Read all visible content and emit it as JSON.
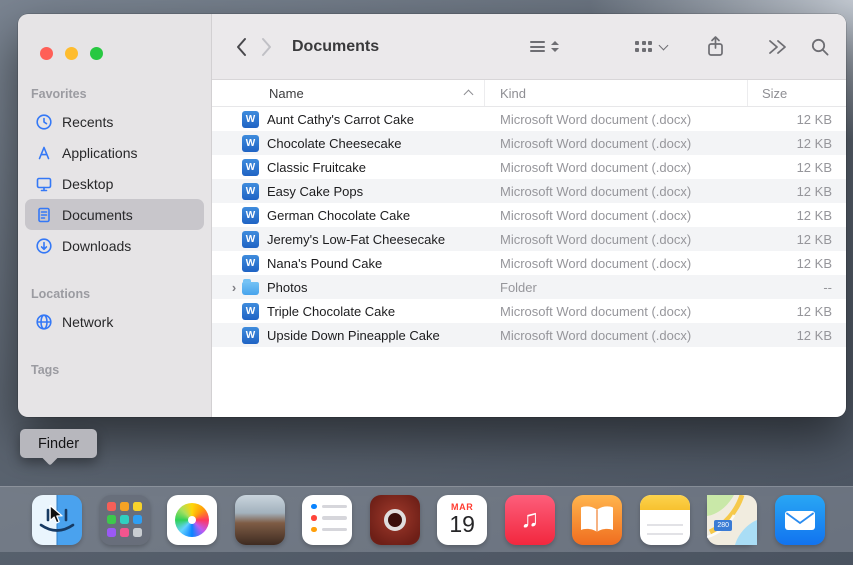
{
  "window": {
    "controls": [
      "close",
      "minimize",
      "zoom"
    ],
    "toolbar": {
      "title": "Documents",
      "icons": [
        "back",
        "forward",
        "view-list",
        "group",
        "share",
        "more",
        "search"
      ]
    },
    "sidebar": {
      "sections": [
        {
          "label": "Favorites",
          "items": [
            {
              "label": "Recents",
              "icon": "clock-icon"
            },
            {
              "label": "Applications",
              "icon": "applications-icon"
            },
            {
              "label": "Desktop",
              "icon": "desktop-icon"
            },
            {
              "label": "Documents",
              "icon": "document-icon",
              "selected": true
            },
            {
              "label": "Downloads",
              "icon": "download-icon"
            }
          ]
        },
        {
          "label": "Locations",
          "items": [
            {
              "label": "Network",
              "icon": "globe-icon"
            }
          ]
        },
        {
          "label": "Tags",
          "items": []
        }
      ]
    },
    "list": {
      "columns": [
        {
          "label": "Name",
          "sorted": "asc"
        },
        {
          "label": "Kind"
        },
        {
          "label": "Size"
        }
      ],
      "word_icon_letter": "W",
      "rows": [
        {
          "name": "Aunt Cathy's Carrot Cake",
          "kind": "Microsoft Word document (.docx)",
          "size": "12 KB",
          "icon": "word"
        },
        {
          "name": "Chocolate Cheesecake",
          "kind": "Microsoft Word document (.docx)",
          "size": "12 KB",
          "icon": "word"
        },
        {
          "name": "Classic Fruitcake",
          "kind": "Microsoft Word document (.docx)",
          "size": "12 KB",
          "icon": "word"
        },
        {
          "name": "Easy Cake Pops",
          "kind": "Microsoft Word document (.docx)",
          "size": "12 KB",
          "icon": "word"
        },
        {
          "name": "German Chocolate Cake",
          "kind": "Microsoft Word document (.docx)",
          "size": "12 KB",
          "icon": "word"
        },
        {
          "name": "Jeremy's Low-Fat Cheesecake",
          "kind": "Microsoft Word document (.docx)",
          "size": "12 KB",
          "icon": "word"
        },
        {
          "name": "Nana's Pound Cake",
          "kind": "Microsoft Word document (.docx)",
          "size": "12 KB",
          "icon": "word"
        },
        {
          "name": "Photos",
          "kind": "Folder",
          "size": "--",
          "icon": "folder",
          "expandable": true
        },
        {
          "name": "Triple Chocolate Cake",
          "kind": "Microsoft Word document (.docx)",
          "size": "12 KB",
          "icon": "word"
        },
        {
          "name": "Upside Down Pineapple Cake",
          "kind": "Microsoft Word document (.docx)",
          "size": "12 KB",
          "icon": "word"
        }
      ]
    }
  },
  "tooltip": {
    "label": "Finder"
  },
  "dock": {
    "items": [
      "finder",
      "launchpad",
      "photos",
      "photo",
      "reminders",
      "photo-booth",
      "calendar",
      "music",
      "books",
      "notes",
      "maps",
      "mail"
    ],
    "calendar": {
      "month": "MAR",
      "day": "19"
    },
    "maps_badge": "280"
  },
  "colors": {
    "accent_blue": "#3478f6",
    "sidebar_selection": "#c8c6cb",
    "row_alt": "#f3f4f6",
    "traffic_red": "#ff5f57",
    "traffic_yellow": "#febc2e",
    "traffic_green": "#28c841"
  }
}
